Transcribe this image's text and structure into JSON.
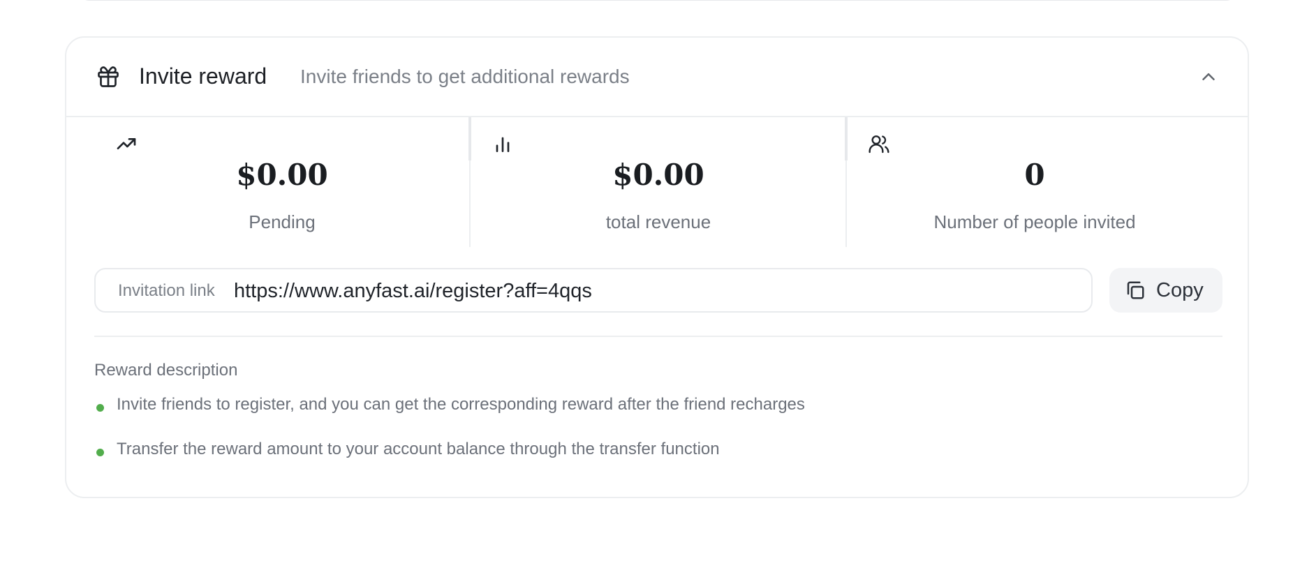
{
  "invite_card": {
    "title": "Invite reward",
    "subtitle": "Invite friends to get additional rewards",
    "header_icon": "gift-icon",
    "collapse_icon": "chevron-up-icon"
  },
  "stats": [
    {
      "icon": "trending-up-icon",
      "value": "$0.00",
      "label": "Pending"
    },
    {
      "icon": "bar-chart-icon",
      "value": "$0.00",
      "label": "total revenue"
    },
    {
      "icon": "users-icon",
      "value": "0",
      "label": "Number of people invited"
    }
  ],
  "invitation": {
    "label": "Invitation link",
    "url": "https://www.anyfast.ai/register?aff=4qqs",
    "copy_label": "Copy",
    "copy_icon": "copy-icon"
  },
  "reward_description": {
    "title": "Reward description",
    "items": [
      "Invite friends to register, and you can get the corresponding reward after the friend recharges",
      "Transfer the reward amount to your account balance through the transfer function"
    ],
    "bullet_color": "#52ad4c"
  }
}
